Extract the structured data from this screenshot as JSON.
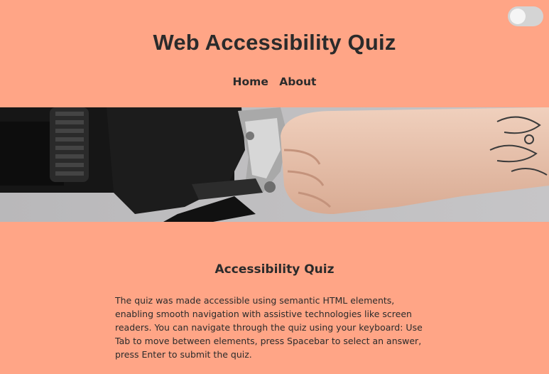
{
  "theme_toggle": {
    "state": "off",
    "icon": "toggle-switch-icon"
  },
  "header": {
    "title": "Web Accessibility Quiz"
  },
  "nav": {
    "items": [
      {
        "label": "Home"
      },
      {
        "label": "About"
      }
    ]
  },
  "hero": {
    "icon": "fist-bump-bike-handle-image"
  },
  "section": {
    "title": "Accessibility Quiz",
    "description": "The quiz was made accessible using semantic HTML elements, enabling smooth navigation with assistive technologies like screen readers. You can navigate through the quiz using your keyboard: Use Tab to move between elements, press Spacebar to select an answer, press Enter to submit the quiz."
  },
  "colors": {
    "background": "#FFA586",
    "text": "#2b2b2b",
    "toggle_track": "#d4d4d4",
    "toggle_knob": "#f5f5f5"
  }
}
